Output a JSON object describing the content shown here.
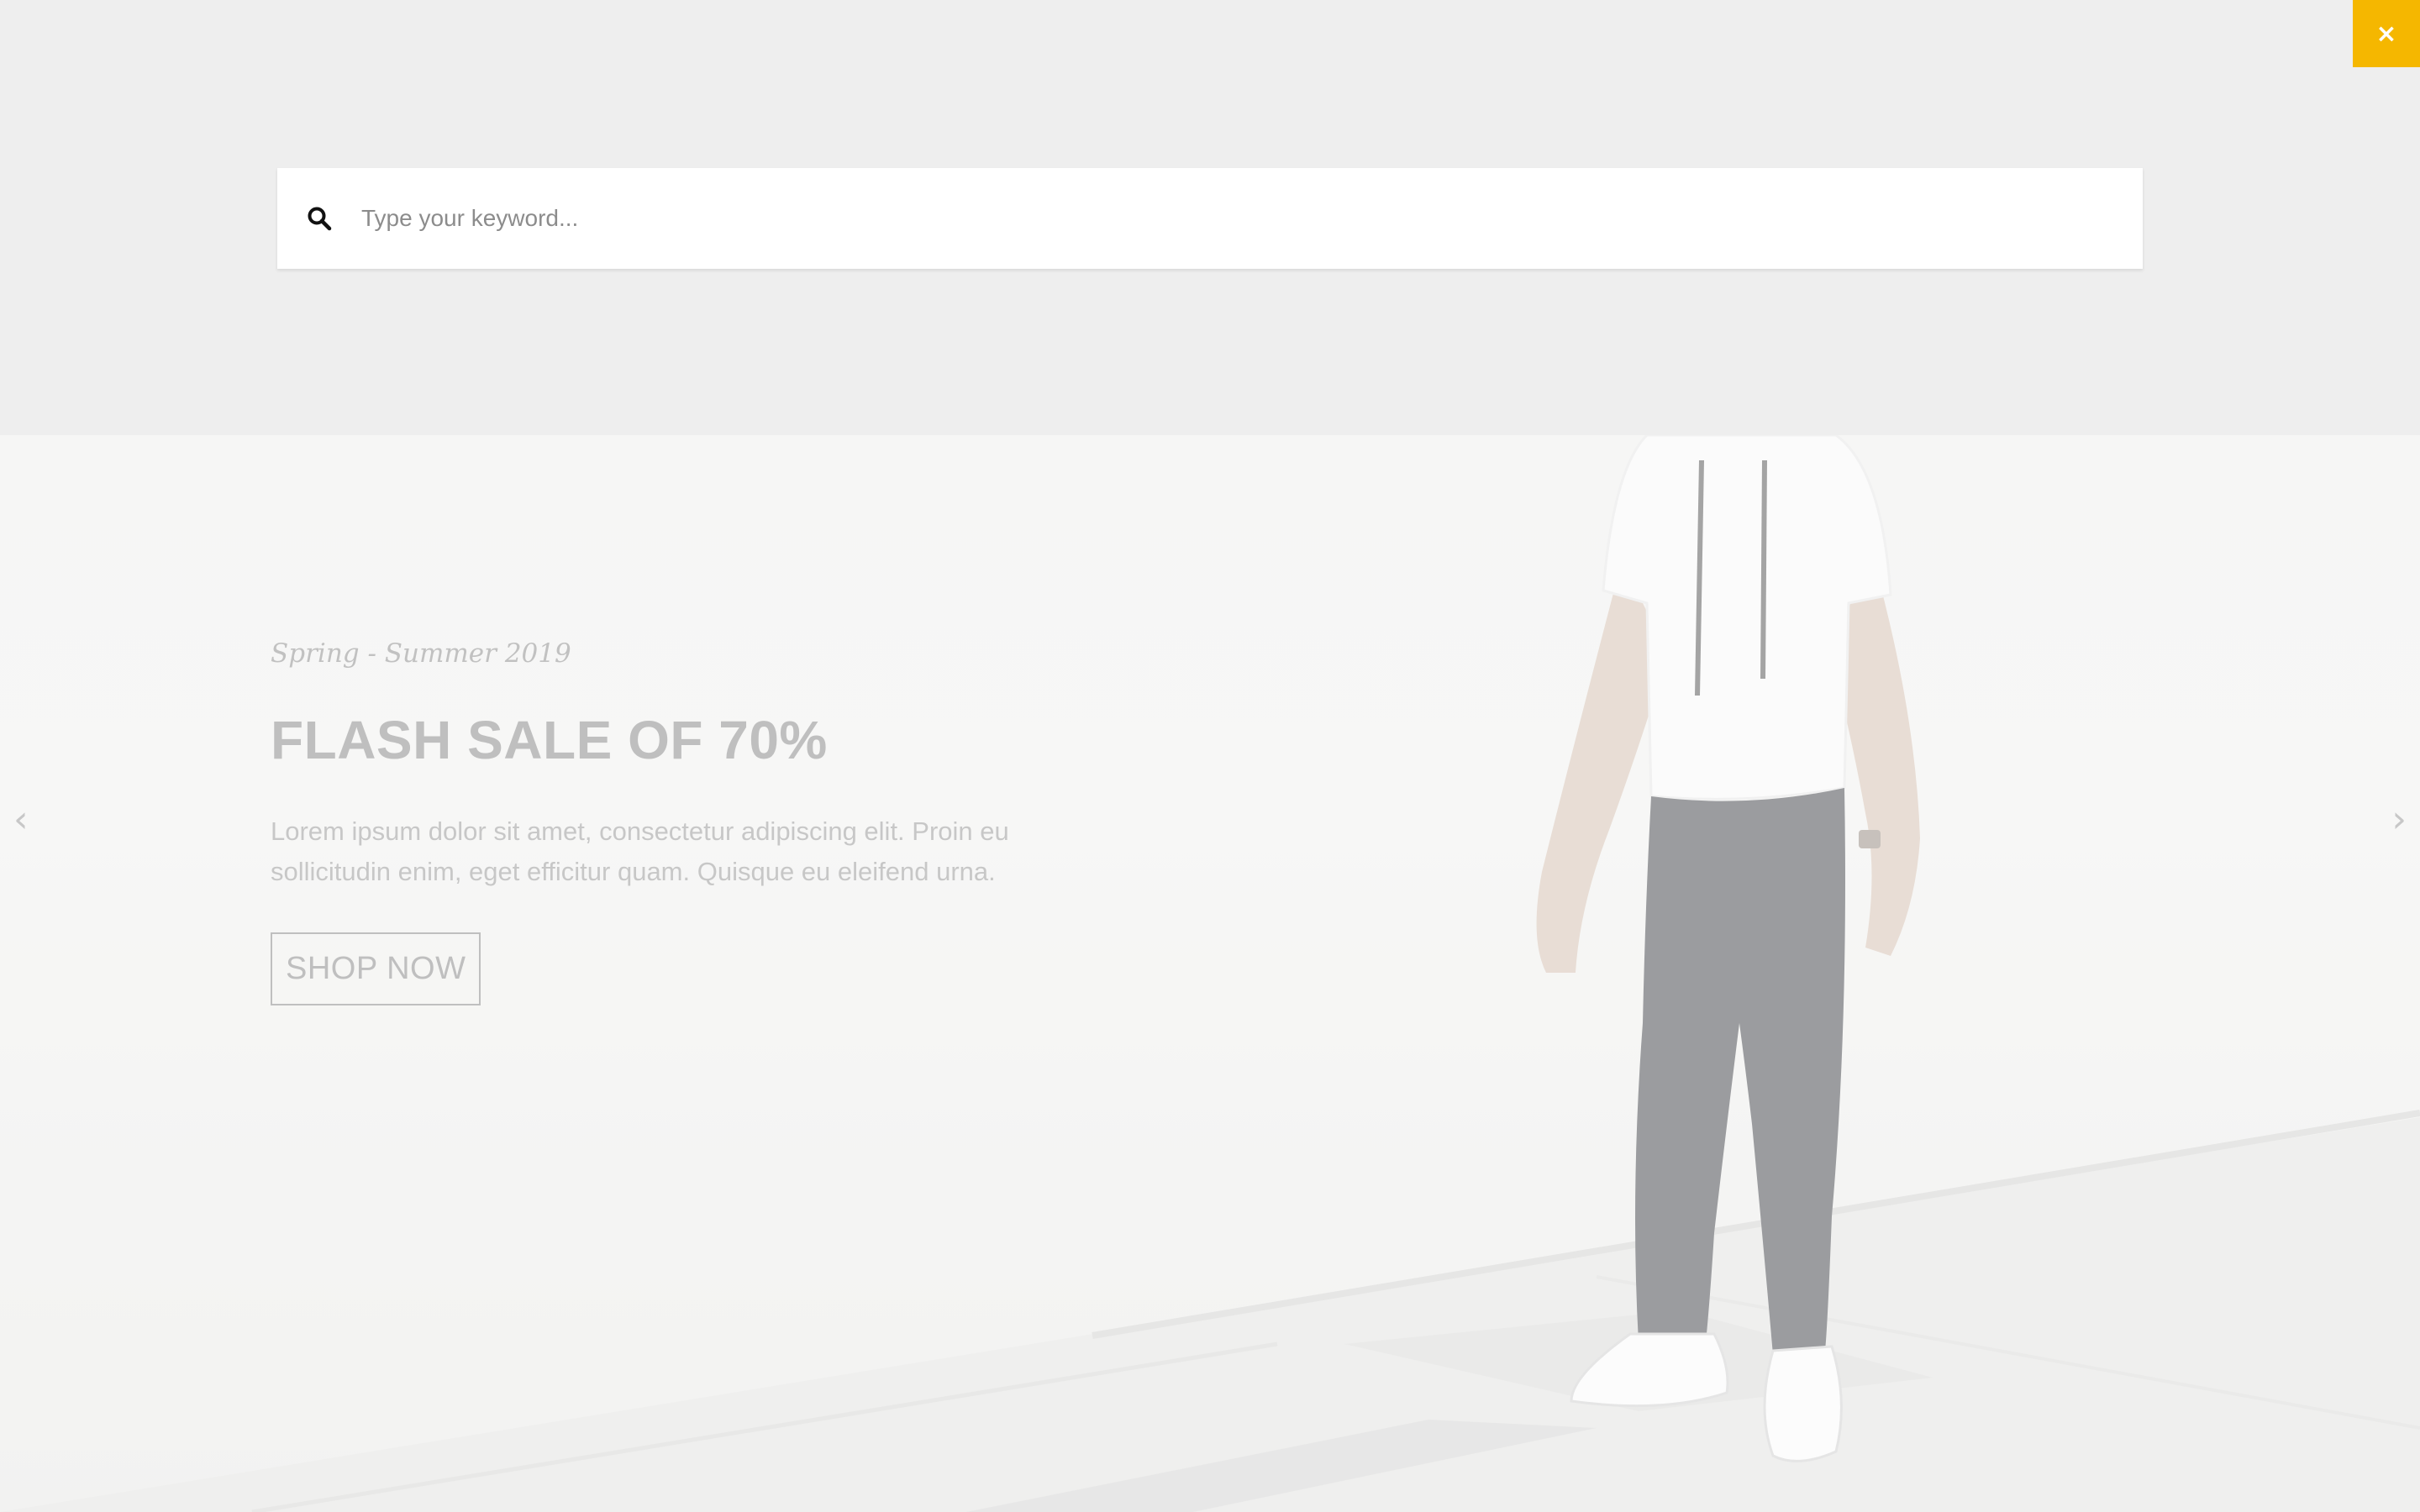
{
  "search": {
    "placeholder": "Type your keyword...",
    "value": ""
  },
  "close_button": {
    "label": "×",
    "icon": "close-icon",
    "color": "#f5b700"
  },
  "hero": {
    "eyebrow": "Spring - Summer 2019",
    "title": "FLASH SALE OF 70%",
    "description": "Lorem ipsum dolor sit amet, consectetur adipiscing elit. Proin eu sollicitudin enim, eget efficitur quam. Quisque eu eleifend urna.",
    "cta_label": "SHOP NOW",
    "prev_arrow": "‹",
    "next_arrow": "›"
  }
}
